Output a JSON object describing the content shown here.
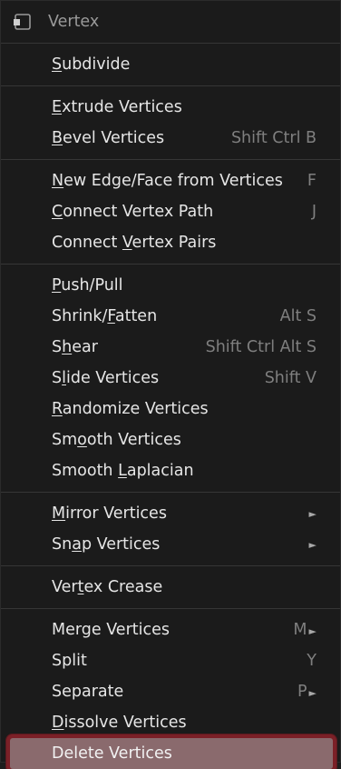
{
  "menu": {
    "title": "Vertex",
    "title_icon": "vertex-select-icon",
    "groups": [
      [
        {
          "label": "Subdivide",
          "mnemonic": "S",
          "shortcut": ""
        }
      ],
      [
        {
          "label": "Extrude Vertices",
          "mnemonic": "E",
          "shortcut": ""
        },
        {
          "label": "Bevel Vertices",
          "mnemonic": "B",
          "shortcut": "Shift Ctrl B"
        }
      ],
      [
        {
          "label": "New Edge/Face from Vertices",
          "mnemonic": "N",
          "shortcut": "F"
        },
        {
          "label": "Connect Vertex Path",
          "mnemonic": "C",
          "shortcut": "J"
        },
        {
          "label": "Connect Vertex Pairs",
          "mnemonic": "V",
          "shortcut": ""
        }
      ],
      [
        {
          "label": "Push/Pull",
          "mnemonic": "P",
          "shortcut": ""
        },
        {
          "label": "Shrink/Fatten",
          "mnemonic": "F",
          "shortcut": "Alt S"
        },
        {
          "label": "Shear",
          "mnemonic": "h",
          "shortcut": "Shift Ctrl Alt S"
        },
        {
          "label": "Slide Vertices",
          "mnemonic": "l",
          "shortcut": "Shift V"
        },
        {
          "label": "Randomize Vertices",
          "mnemonic": "R",
          "shortcut": ""
        },
        {
          "label": "Smooth Vertices",
          "mnemonic": "o",
          "shortcut": ""
        },
        {
          "label": "Smooth Laplacian",
          "mnemonic": "L",
          "shortcut": ""
        }
      ],
      [
        {
          "label": "Mirror Vertices",
          "mnemonic": "M",
          "submenu": true,
          "shortcut": ""
        },
        {
          "label": "Snap Vertices",
          "mnemonic": "a",
          "submenu": true,
          "shortcut": ""
        }
      ],
      [
        {
          "label": "Vertex Crease",
          "mnemonic": "t",
          "shortcut": ""
        }
      ],
      [
        {
          "label": "Merge Vertices",
          "mnemonic": "",
          "shortcut": "M",
          "submenu": true
        },
        {
          "label": "Split",
          "mnemonic": "",
          "shortcut": "Y"
        },
        {
          "label": "Separate",
          "mnemonic": "",
          "shortcut": "P",
          "submenu": true
        },
        {
          "label": "Dissolve Vertices",
          "mnemonic": "D",
          "shortcut": ""
        },
        {
          "label": "Delete Vertices",
          "mnemonic": "",
          "shortcut": "",
          "highlighted": true
        }
      ]
    ],
    "submenu_arrow": "►",
    "colors": {
      "background": "#1b1b1b",
      "text": "#e6e6e6",
      "shortcut": "#7f7f7f",
      "separator": "#363636",
      "highlight_fill": "#8a6a6d",
      "highlight_border": "#7b2027"
    }
  }
}
